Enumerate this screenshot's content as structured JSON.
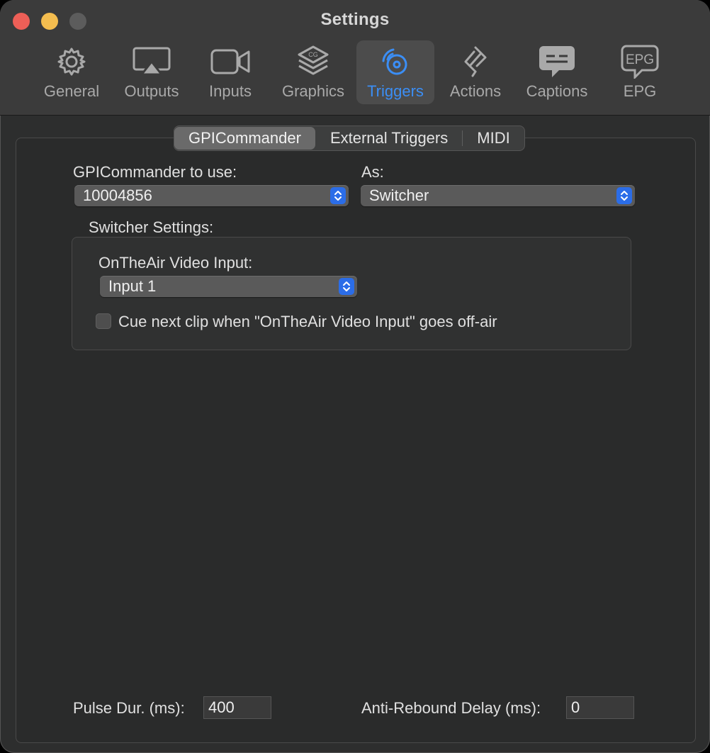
{
  "window": {
    "title": "Settings"
  },
  "tabs": [
    {
      "label": "General",
      "icon": "gear-icon"
    },
    {
      "label": "Outputs",
      "icon": "airplay-icon"
    },
    {
      "label": "Inputs",
      "icon": "video-camera-icon"
    },
    {
      "label": "Graphics",
      "icon": "layers-cg-icon"
    },
    {
      "label": "Triggers",
      "icon": "trigger-signal-icon",
      "active": true
    },
    {
      "label": "Actions",
      "icon": "actions-icon"
    },
    {
      "label": "Captions",
      "icon": "captions-bubble-icon"
    },
    {
      "label": "EPG",
      "icon": "epg-bubble-icon",
      "icon_text": "EPG"
    }
  ],
  "segmented": {
    "items": [
      "GPICommander",
      "External Triggers",
      "MIDI"
    ],
    "selected": "GPICommander"
  },
  "form": {
    "gpi_label": "GPICommander to use:",
    "gpi_value": "10004856",
    "as_label": "As:",
    "as_value": "Switcher",
    "switcher_settings_label": "Switcher Settings:",
    "video_input_label": "OnTheAir Video Input:",
    "video_input_value": "Input 1",
    "cue_checkbox_label": "Cue next clip when \"OnTheAir Video Input\" goes off-air",
    "cue_checked": false,
    "pulse_label": "Pulse Dur. (ms):",
    "pulse_value": "400",
    "rebound_label": "Anti-Rebound Delay (ms):",
    "rebound_value": "0"
  },
  "colors": {
    "accent": "#3b8ef5",
    "close": "#ed5f57",
    "minimize": "#f4bd4f",
    "popup_chevron": "#2b6de8"
  }
}
